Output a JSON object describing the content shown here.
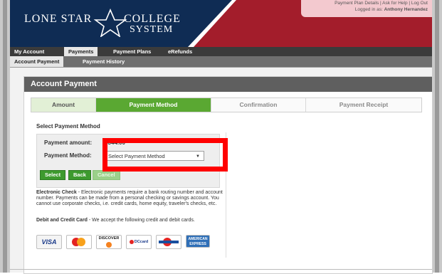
{
  "header": {
    "logo_line1": "LONE STAR",
    "logo_line2": "COLLEGE",
    "logo_line3": "SYSTEM",
    "top_links": "Payment Plan Details  |  Ask for Help  |  Log Out",
    "logged_in_label": "Logged in as:",
    "logged_in_user": "Anthony Hernandez"
  },
  "nav_primary": [
    "My Account",
    "Payments",
    "Payment Plans",
    "eRefunds"
  ],
  "nav_secondary": [
    "Account Payment",
    "Payment History"
  ],
  "card": {
    "title": "Account Payment",
    "steps": [
      "Amount",
      "Payment Method",
      "Confirmation",
      "Payment Receipt"
    ],
    "current_step": "Payment Method",
    "section_title": "Select Payment Method",
    "payment_amount_label": "Payment amount:",
    "payment_amount_value": "$344.00",
    "payment_method_label": "Payment Method:",
    "payment_method_selected": "Select Payment Method",
    "buttons": {
      "select": "Select",
      "back": "Back",
      "cancel": "Cancel"
    },
    "echeck_title": "Electronic Check",
    "echeck_text": " - Electronic payments require a bank routing number and account number. Payments can be made from a personal checking or savings account. You cannot use corporate checks, i.e. credit cards, home equity, traveler's checks, etc.",
    "card_title": "Debit and Credit Card",
    "card_text": " - We accept the following credit and debit cards.",
    "card_logos": [
      "VISA",
      "MasterCard",
      "DISCOVER",
      "DCcard",
      "Diners Club",
      "AMERICAN EXPRESS"
    ]
  },
  "colors": {
    "header_navy": "#0f2c54",
    "header_red": "#a31d2b",
    "step_active": "#5aa832",
    "button_green": "#3d9a2e",
    "annotation_red": "#ff0000"
  }
}
